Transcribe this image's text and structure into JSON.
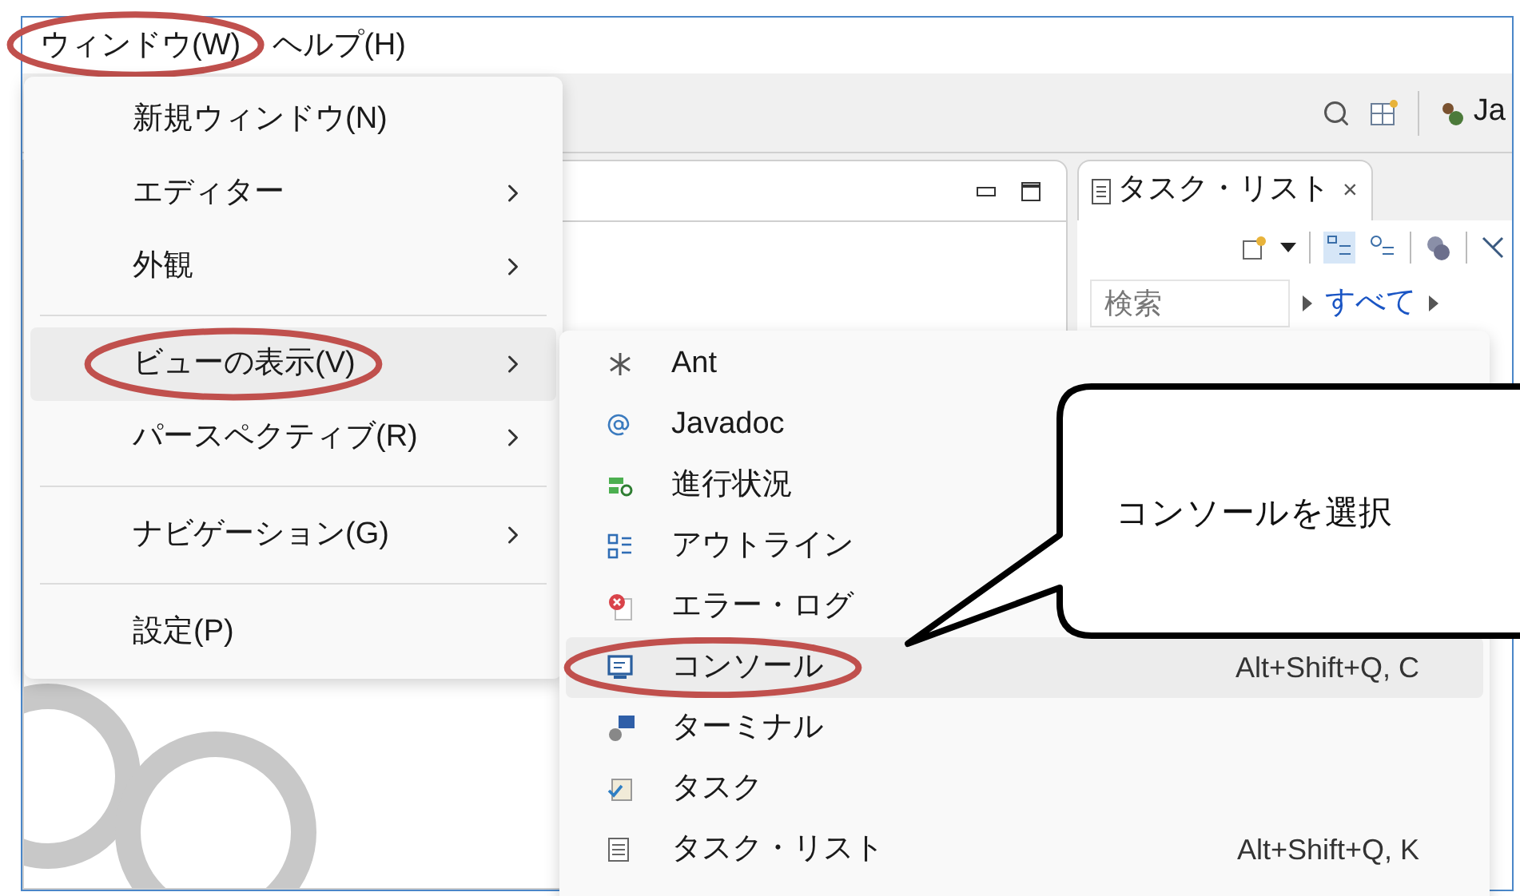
{
  "menu_bar": [
    {
      "label": "ウィンドウ(W)",
      "circled": true
    },
    {
      "label": "ヘルプ(H)",
      "circled": false
    }
  ],
  "toolbar": {
    "perspective_label": "Ja"
  },
  "task_list": {
    "tab_title": "タスク・リスト",
    "close": "×",
    "search_placeholder": "検索",
    "filter_label": "すべて"
  },
  "window_menu": {
    "items": [
      {
        "label": "新規ウィンドウ(N)",
        "submenu": false,
        "selected": false,
        "circled": false,
        "separator_before": false
      },
      {
        "label": "エディター",
        "submenu": true,
        "selected": false,
        "circled": false,
        "separator_before": false
      },
      {
        "label": "外観",
        "submenu": true,
        "selected": false,
        "circled": false,
        "separator_before": false
      },
      {
        "label": "ビューの表示(V)",
        "submenu": true,
        "selected": true,
        "circled": true,
        "separator_before": true
      },
      {
        "label": "パースペクティブ(R)",
        "submenu": true,
        "selected": false,
        "circled": false,
        "separator_before": false
      },
      {
        "label": "ナビゲーション(G)",
        "submenu": true,
        "selected": false,
        "circled": false,
        "separator_before": true
      },
      {
        "label": "設定(P)",
        "submenu": false,
        "selected": false,
        "circled": false,
        "separator_before": true
      }
    ]
  },
  "view_submenu": {
    "items": [
      {
        "label": "Ant",
        "selected": false,
        "circled": false
      },
      {
        "label": "Javadoc",
        "selected": false,
        "circled": false
      },
      {
        "label": "進行状況",
        "selected": false,
        "circled": false
      },
      {
        "label": "アウトライン",
        "selected": false,
        "circled": false
      },
      {
        "label": "エラー・ログ",
        "selected": false,
        "circled": false
      },
      {
        "label": "コンソール",
        "shortcut": "Alt+Shift+Q, C",
        "selected": true,
        "circled": true
      },
      {
        "label": "ターミナル",
        "selected": false,
        "circled": false
      },
      {
        "label": "タスク",
        "selected": false,
        "circled": false
      },
      {
        "label": "タスク・リスト",
        "shortcut": "Alt+Shift+Q, K",
        "selected": false,
        "circled": false
      }
    ]
  },
  "callout": {
    "text": "コンソールを選択"
  }
}
